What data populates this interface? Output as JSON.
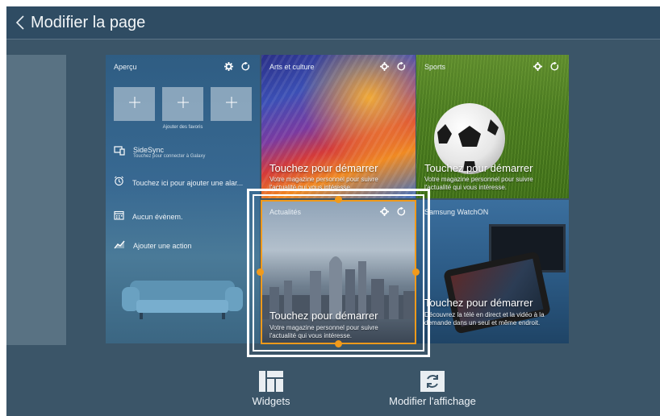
{
  "header": {
    "title": "Modifier la page"
  },
  "panels": {
    "apercu": {
      "title": "Aperçu",
      "favorites_caption": "Ajouter des favoris",
      "rows": [
        {
          "label": "SideSync",
          "sub": "Touchez pour connecter à Galaxy"
        },
        {
          "label": "Touchez ici pour ajouter une alar..."
        },
        {
          "label": "Aucun évènem."
        },
        {
          "label": "Ajouter une action"
        }
      ]
    },
    "arts": {
      "title": "Arts et culture",
      "headline": "Touchez pour démarrer",
      "desc": "Votre magazine personnel pour suivre l'actualité qui vous intéresse."
    },
    "sports": {
      "title": "Sports",
      "headline": "Touchez pour démarrer",
      "desc": "Votre magazine personnel pour suivre l'actualité qui vous intéresse."
    },
    "actualites": {
      "title": "Actualités",
      "headline": "Touchez pour démarrer",
      "desc": "Votre magazine personnel pour suivre l'actualité qui vous intéresse."
    },
    "watchon": {
      "title": "Samsung WatchON",
      "headline": "Touchez pour démarrer",
      "desc": "Découvrez la télé en direct et la vidéo à la demande dans un seul et même endroit."
    }
  },
  "bottom": {
    "widgets_label": "Widgets",
    "layout_label": "Modifier l'affichage"
  },
  "colors": {
    "selection_accent": "#f19a1b",
    "topbar": "#2f4c63",
    "background": "#3b5568"
  }
}
